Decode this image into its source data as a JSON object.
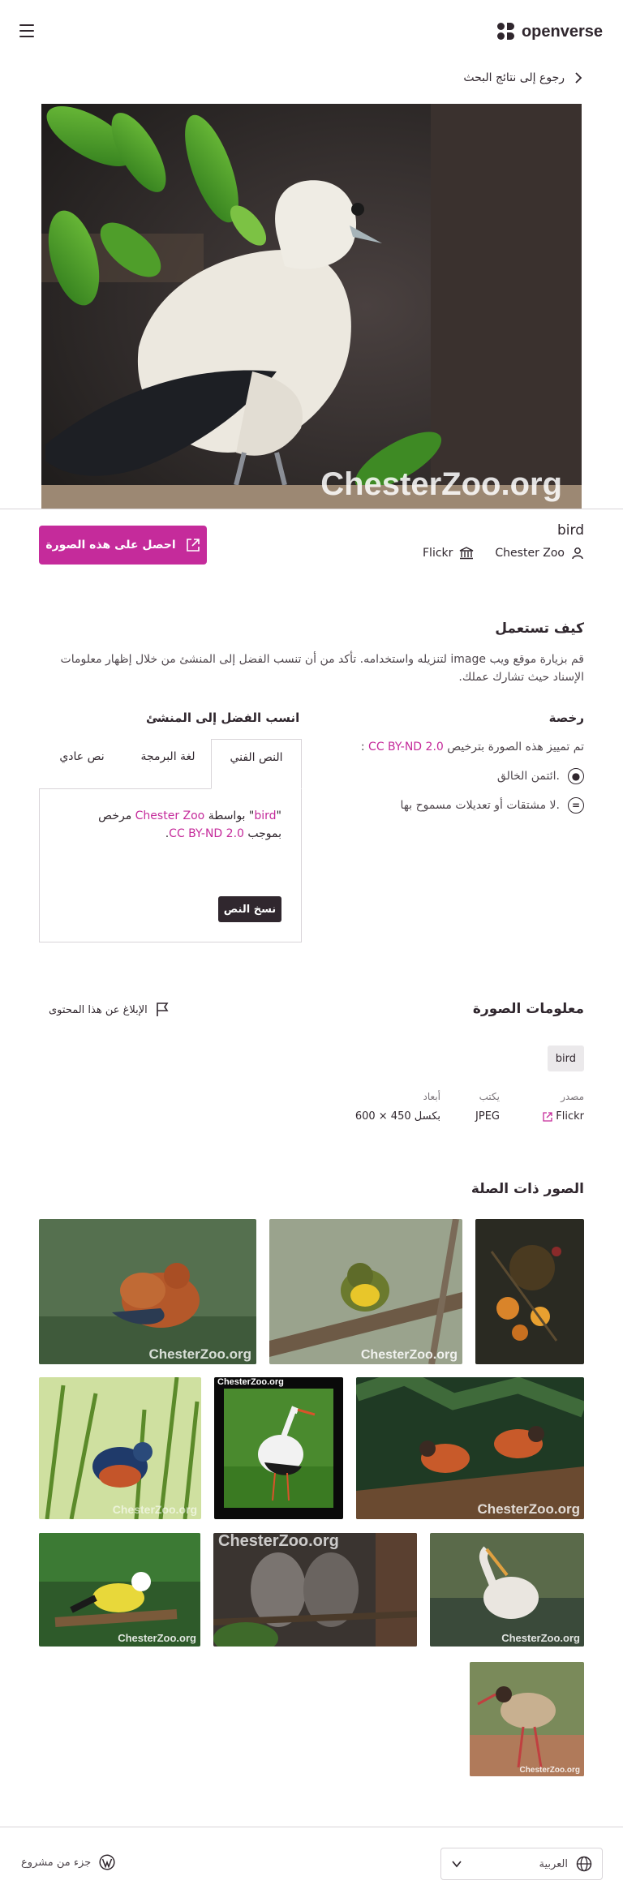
{
  "header": {
    "logo_text": "openverse"
  },
  "nav": {
    "back_label": "رجوع إلى نتائج البحث"
  },
  "main_image": {
    "watermark": "ChesterZoo.org"
  },
  "image": {
    "title": "bird",
    "creator": "Chester Zoo",
    "source": "Flickr",
    "get_button": "احصل على هذه الصورة"
  },
  "how_to_use": {
    "heading": "كيف تستعمل",
    "text_pre": "قم بزيارة موقع ويب",
    "text_link": "image",
    "text_post": "لتنزيله واستخدامه. تأكد من أن تنسب الفضل إلى المنشئ من خلال إظهار معلومات الإسناد حيث تشارك عملك."
  },
  "license": {
    "label": "رخصة",
    "text_pre": "تم تمييز هذه الصورة بترخيص",
    "license_name": "CC BY-ND 2.0",
    "text_post": ":",
    "items": [
      {
        "icon": "person-icon",
        "text": "ائتمن الخالق."
      },
      {
        "icon": "equals-icon",
        "text": "لا مشتقات أو تعديلات مسموح بها."
      }
    ]
  },
  "attribution": {
    "heading": "انسب الفضل إلى المنشئ",
    "tabs": [
      "النص الفني",
      "لغة البرمجة",
      "نص عادي"
    ],
    "q_open": "\"",
    "title_link": "bird",
    "q_close": "\"",
    "by": "بواسطة",
    "creator_link": "Chester Zoo",
    "licensed": "مرخص بموجب",
    "license_link": "CC BY-ND 2.0",
    "end": ".",
    "copy_button": "نسخ النص"
  },
  "info": {
    "heading": "معلومات الصورة",
    "report": "الإبلاغ عن هذا المحتوى",
    "tag": "bird",
    "source_label": "مصدر",
    "source_value": "Flickr",
    "type_label": "يكتب",
    "type_value": "JPEG",
    "dims_label": "أبعاد",
    "dims_value": "600 × 450 بكسل"
  },
  "related": {
    "heading": "الصور ذات الصلة",
    "watermark": "ChesterZoo.org"
  },
  "footer": {
    "part_of": "جزء من مشروع",
    "language": "العربية"
  },
  "colors": {
    "accent": "#c52b9b",
    "text": "#30272e",
    "border": "#d8d4d8"
  }
}
